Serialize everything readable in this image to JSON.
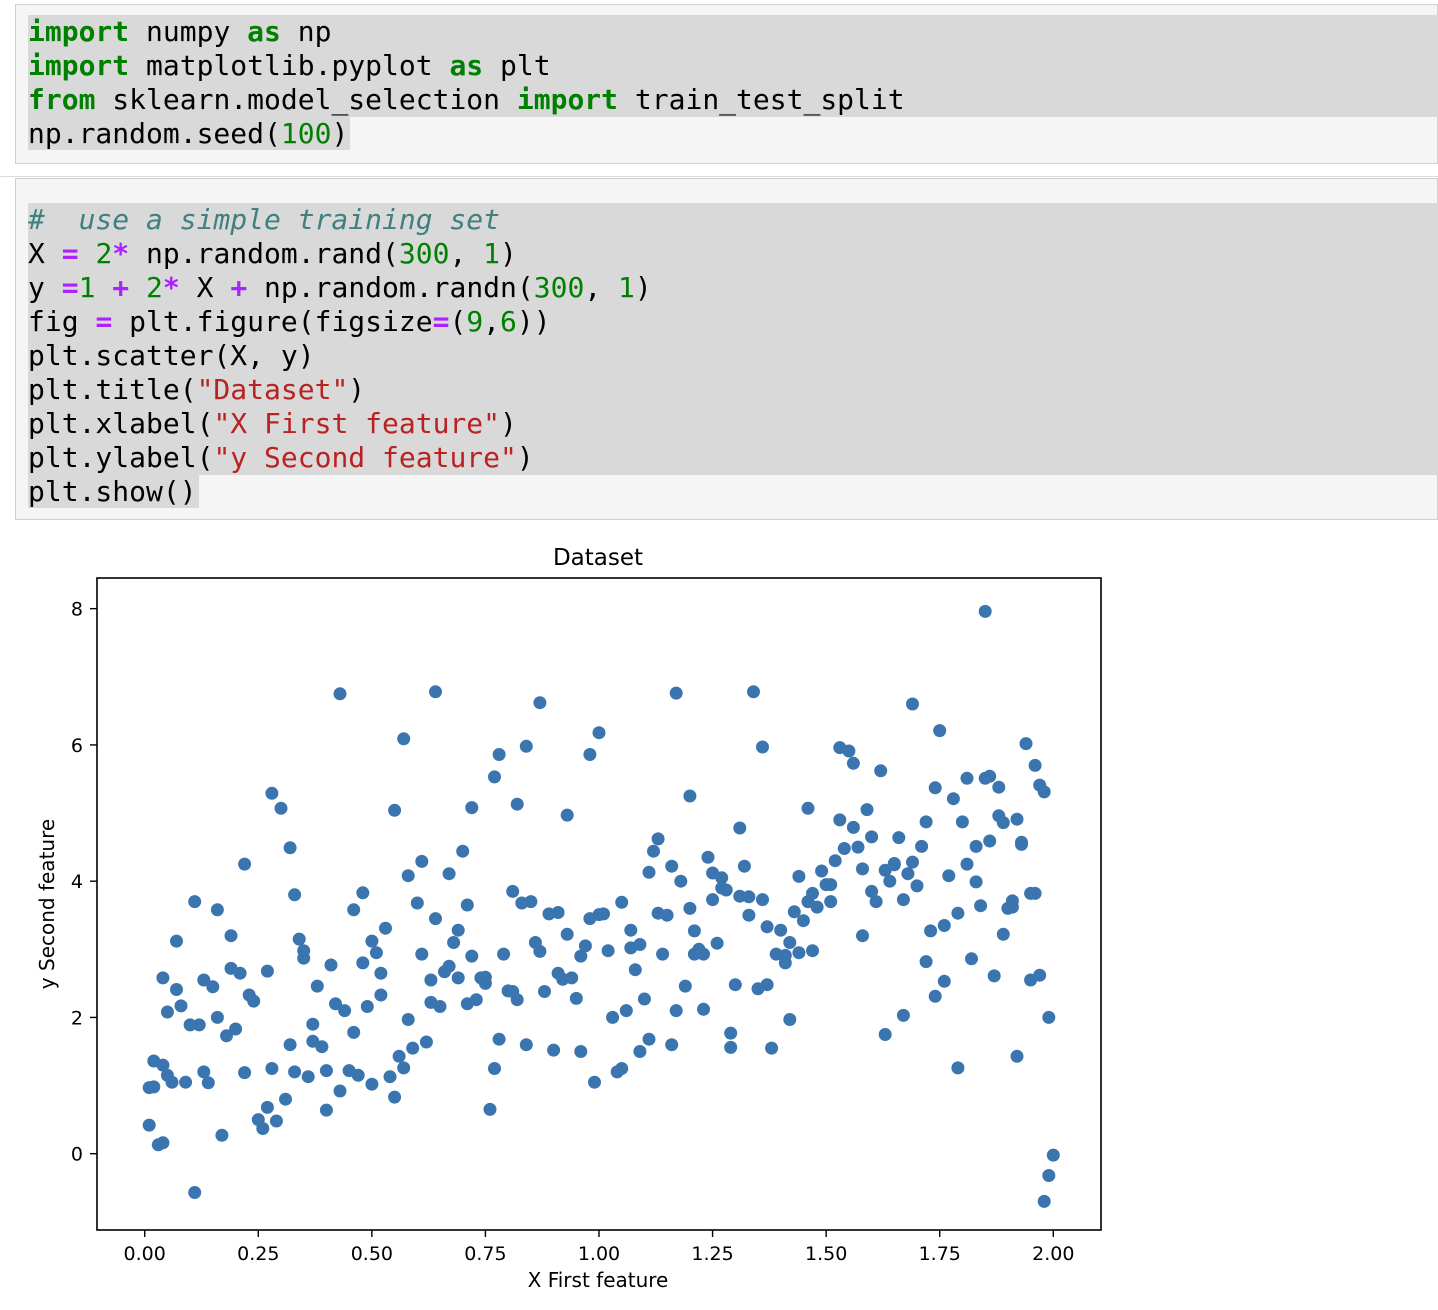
{
  "cells": [
    {
      "lines": [
        [
          [
            "kw",
            "import"
          ],
          [
            "t",
            " numpy "
          ],
          [
            "kw",
            "as"
          ],
          [
            "t",
            " np"
          ]
        ],
        [
          [
            "kw",
            "import"
          ],
          [
            "t",
            " matplotlib.pyplot "
          ],
          [
            "kw",
            "as"
          ],
          [
            "t",
            " plt"
          ]
        ],
        [
          [
            "kw",
            "from"
          ],
          [
            "t",
            " sklearn.model_selection "
          ],
          [
            "kw",
            "import"
          ],
          [
            "t",
            " train_test_split"
          ]
        ],
        [
          [
            "t",
            "np.random.seed("
          ],
          [
            "num",
            "100"
          ],
          [
            "t",
            ")"
          ]
        ]
      ]
    },
    {
      "lines": [
        [
          [
            "cm",
            "#  use a simple training set"
          ]
        ],
        [
          [
            "t",
            "X "
          ],
          [
            "op",
            "="
          ],
          [
            "t",
            " "
          ],
          [
            "num",
            "2"
          ],
          [
            "op",
            "*"
          ],
          [
            "t",
            " np.random.rand("
          ],
          [
            "num",
            "300"
          ],
          [
            "t",
            ", "
          ],
          [
            "num",
            "1"
          ],
          [
            "t",
            ")"
          ]
        ],
        [
          [
            "t",
            "y "
          ],
          [
            "op",
            "="
          ],
          [
            "num",
            "1"
          ],
          [
            "t",
            " "
          ],
          [
            "op",
            "+"
          ],
          [
            "t",
            " "
          ],
          [
            "num",
            "2"
          ],
          [
            "op",
            "*"
          ],
          [
            "t",
            " X "
          ],
          [
            "op",
            "+"
          ],
          [
            "t",
            " np.random.randn("
          ],
          [
            "num",
            "300"
          ],
          [
            "t",
            ", "
          ],
          [
            "num",
            "1"
          ],
          [
            "t",
            ")"
          ]
        ],
        [
          [
            "t",
            "fig "
          ],
          [
            "op",
            "="
          ],
          [
            "t",
            " plt.figure(figsize"
          ],
          [
            "op",
            "="
          ],
          [
            "t",
            "("
          ],
          [
            "num",
            "9"
          ],
          [
            "t",
            ","
          ],
          [
            "num",
            "6"
          ],
          [
            "t",
            "))"
          ]
        ],
        [
          [
            "t",
            "plt.scatter(X, y)"
          ]
        ],
        [
          [
            "t",
            "plt.title("
          ],
          [
            "str",
            "\"Dataset\""
          ],
          [
            "t",
            ")"
          ]
        ],
        [
          [
            "t",
            "plt.xlabel("
          ],
          [
            "str",
            "\"X First feature\""
          ],
          [
            "t",
            ")"
          ]
        ],
        [
          [
            "t",
            "plt.ylabel("
          ],
          [
            "str",
            "\"y Second feature\""
          ],
          [
            "t",
            ")"
          ]
        ],
        [
          [
            "t",
            "plt.show()"
          ]
        ]
      ]
    }
  ],
  "colors": {
    "keyword": "#008000",
    "number": "#008000",
    "operator": "#aa22ff",
    "string": "#ba2121",
    "comment": "#408080",
    "marker": "#3b75af"
  },
  "chart_data": {
    "type": "scatter",
    "title": "Dataset",
    "xlabel": "X First feature",
    "ylabel": "y Second feature",
    "xlim": [
      -0.105,
      2.105
    ],
    "ylim": [
      -1.12,
      8.45
    ],
    "xticks": [
      0.0,
      0.25,
      0.5,
      0.75,
      1.0,
      1.25,
      1.5,
      1.75,
      2.0
    ],
    "xtick_labels": [
      "0.00",
      "0.25",
      "0.50",
      "0.75",
      "1.00",
      "1.25",
      "1.50",
      "1.75",
      "2.00"
    ],
    "yticks": [
      0,
      2,
      4,
      6,
      8
    ],
    "ytick_labels": [
      "0",
      "2",
      "4",
      "6",
      "8"
    ],
    "grid": false,
    "marker_color": "#3b75af",
    "x": [
      0.01,
      0.01,
      0.02,
      0.03,
      0.04,
      0.04,
      0.05,
      0.05,
      0.06,
      0.07,
      0.08,
      0.09,
      0.1,
      0.11,
      0.12,
      0.13,
      0.14,
      0.15,
      0.16,
      0.17,
      0.18,
      0.19,
      0.2,
      0.21,
      0.22,
      0.23,
      0.25,
      0.26,
      0.27,
      0.27,
      0.28,
      0.29,
      0.31,
      0.32,
      0.33,
      0.33,
      0.34,
      0.35,
      0.36,
      0.37,
      0.38,
      0.39,
      0.4,
      0.41,
      0.42,
      0.43,
      0.44,
      0.45,
      0.46,
      0.47,
      0.48,
      0.49,
      0.5,
      0.5,
      0.51,
      0.52,
      0.53,
      0.54,
      0.55,
      0.56,
      0.57,
      0.58,
      0.59,
      0.6,
      0.61,
      0.62,
      0.63,
      0.64,
      0.65,
      0.66,
      0.67,
      0.68,
      0.69,
      0.7,
      0.71,
      0.72,
      0.73,
      0.74,
      0.75,
      0.76,
      0.77,
      0.78,
      0.79,
      0.8,
      0.81,
      0.82,
      0.83,
      0.84,
      0.85,
      0.86,
      0.87,
      0.88,
      0.89,
      0.9,
      0.91,
      0.92,
      0.93,
      0.94,
      0.95,
      0.96,
      0.97,
      0.98,
      0.99,
      1.0,
      1.01,
      1.02,
      1.03,
      1.04,
      1.05,
      1.06,
      1.07,
      1.08,
      1.09,
      1.1,
      1.11,
      1.12,
      1.13,
      1.14,
      1.15,
      1.16,
      1.17,
      1.18,
      1.19,
      1.2,
      1.21,
      1.22,
      1.23,
      1.24,
      1.25,
      1.26,
      1.27,
      1.28,
      1.29,
      1.3,
      1.31,
      1.32,
      1.33,
      1.34,
      1.35,
      1.36,
      1.37,
      1.38,
      1.39,
      1.4,
      1.41,
      1.42,
      1.43,
      1.44,
      1.45,
      1.46,
      1.47,
      1.48,
      1.49,
      1.5,
      1.51,
      1.52,
      1.53,
      1.54,
      1.55,
      1.56,
      1.57,
      1.58,
      1.59,
      1.6,
      1.61,
      1.62,
      1.63,
      1.64,
      1.65,
      1.66,
      1.67,
      1.68,
      1.69,
      1.7,
      1.71,
      1.72,
      1.73,
      1.74,
      1.75,
      1.76,
      1.77,
      1.78,
      1.79,
      1.8,
      1.81,
      1.82,
      1.83,
      1.84,
      1.85,
      1.86,
      1.87,
      1.88,
      1.89,
      1.9,
      1.91,
      1.92,
      1.93,
      1.94,
      1.95,
      1.96,
      1.97,
      1.98,
      1.99,
      2.0,
      0.04,
      0.28,
      0.11,
      0.22,
      0.32,
      0.57,
      0.64,
      0.77,
      0.72,
      0.87,
      1.0,
      1.2,
      1.36,
      1.46,
      1.6,
      1.74,
      1.92,
      1.97,
      1.91,
      1.81,
      1.21,
      1.27,
      1.33,
      1.63,
      0.48,
      0.55,
      0.67,
      0.82,
      0.93,
      1.05,
      1.16,
      1.41,
      1.72,
      1.79,
      1.88,
      0.16,
      0.3,
      0.43,
      0.61,
      0.78,
      1.13,
      1.25,
      1.53,
      1.67,
      1.95,
      0.07,
      0.35,
      0.52,
      0.69,
      0.84,
      0.98,
      1.17,
      1.31,
      1.44,
      1.58,
      1.85,
      1.99,
      0.19,
      0.4,
      0.58,
      0.75,
      0.91,
      1.09,
      1.23,
      1.37,
      1.51,
      1.69,
      1.83,
      1.93,
      0.13,
      0.24,
      0.46,
      0.63,
      0.81,
      0.96,
      1.11,
      1.29,
      1.42,
      1.56,
      1.76,
      1.86,
      1.98,
      0.02,
      0.37,
      0.71,
      1.07,
      1.47,
      1.65,
      1.89,
      1.96
    ],
    "y": [
      0.97,
      0.42,
      0.98,
      0.13,
      2.58,
      1.3,
      2.08,
      1.15,
      1.05,
      2.41,
      2.17,
      1.05,
      1.89,
      -0.57,
      1.89,
      2.55,
      1.04,
      2.45,
      2.0,
      0.27,
      1.73,
      3.2,
      1.83,
      2.65,
      1.19,
      2.33,
      0.5,
      0.37,
      0.68,
      2.68,
      1.25,
      0.48,
      0.8,
      1.6,
      3.8,
      1.2,
      3.15,
      2.87,
      1.13,
      1.65,
      2.46,
      1.57,
      0.64,
      2.77,
      2.2,
      0.92,
      2.1,
      1.22,
      3.58,
      1.15,
      2.8,
      2.16,
      1.02,
      3.12,
      2.95,
      2.65,
      3.31,
      1.13,
      0.83,
      1.43,
      1.26,
      1.97,
      1.55,
      3.68,
      2.93,
      1.64,
      2.55,
      3.45,
      2.16,
      2.67,
      2.75,
      3.1,
      2.58,
      4.44,
      2.2,
      2.9,
      2.26,
      2.58,
      2.5,
      0.65,
      1.25,
      1.68,
      2.93,
      2.39,
      3.85,
      2.26,
      3.68,
      1.6,
      3.7,
      3.1,
      2.97,
      2.38,
      3.52,
      1.52,
      2.65,
      2.56,
      3.22,
      2.58,
      2.28,
      2.9,
      3.05,
      3.45,
      1.05,
      3.51,
      3.52,
      2.98,
      2.0,
      1.2,
      3.69,
      2.1,
      3.02,
      2.7,
      1.5,
      2.27,
      1.68,
      4.44,
      3.53,
      2.93,
      3.5,
      4.22,
      2.1,
      4.0,
      2.46,
      3.6,
      2.93,
      3.0,
      2.12,
      4.35,
      3.73,
      3.09,
      4.05,
      3.87,
      1.56,
      2.48,
      3.78,
      4.22,
      3.77,
      6.78,
      2.42,
      3.73,
      2.48,
      1.55,
      2.93,
      3.28,
      2.8,
      3.1,
      3.55,
      2.95,
      3.42,
      3.7,
      3.82,
      3.62,
      4.15,
      3.95,
      3.7,
      4.3,
      4.9,
      4.48,
      5.91,
      5.73,
      4.5,
      3.2,
      5.05,
      3.85,
      3.7,
      5.62,
      4.16,
      4.0,
      4.26,
      4.64,
      3.73,
      4.11,
      6.6,
      3.93,
      4.51,
      4.87,
      3.27,
      2.31,
      6.21,
      3.35,
      4.08,
      5.21,
      3.53,
      4.87,
      5.51,
      2.86,
      3.99,
      3.64,
      7.96,
      5.54,
      2.61,
      5.38,
      4.86,
      3.6,
      3.71,
      4.91,
      4.54,
      6.02,
      3.82,
      3.82,
      5.41,
      -0.7,
      -0.32,
      -0.02,
      0.16,
      5.29,
      3.7,
      4.25,
      4.49,
      6.09,
      6.78,
      5.53,
      5.08,
      6.62,
      6.18,
      5.25,
      5.97,
      5.07,
      4.65,
      5.37,
      1.43,
      2.62,
      3.62,
      4.25,
      3.27,
      3.9,
      3.5,
      1.75,
      3.83,
      5.04,
      4.11,
      5.13,
      4.97,
      1.25,
      1.6,
      2.91,
      2.82,
      1.26,
      4.96,
      3.58,
      5.07,
      6.75,
      4.29,
      5.86,
      4.62,
      4.12,
      5.96,
      2.03,
      2.55,
      3.12,
      2.98,
      2.33,
      3.28,
      5.98,
      5.86,
      6.76,
      4.78,
      4.07,
      4.18,
      5.51,
      2.0,
      2.72,
      1.22,
      4.08,
      2.59,
      3.54,
      3.07,
      2.93,
      3.33,
      3.95,
      4.28,
      4.51,
      4.57,
      1.2,
      2.24,
      1.78,
      2.22,
      2.38,
      1.5,
      4.13,
      1.77,
      1.97,
      4.79,
      2.53,
      4.59,
      5.31,
      1.36,
      1.9,
      3.65,
      3.28,
      2.98,
      4.24,
      3.22,
      5.7
    ]
  }
}
